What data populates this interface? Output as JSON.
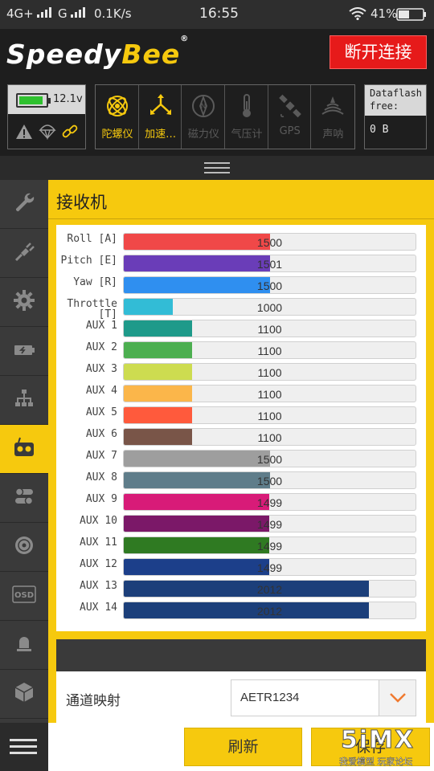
{
  "status_bar": {
    "network1": "4G+",
    "network2": "G",
    "speed": "0.1K/s",
    "time": "16:55",
    "battery_pct": "41%"
  },
  "app": {
    "logo_part1": "Speedy",
    "logo_part2": "Bee",
    "logo_mark": "®",
    "disconnect_label": "断开连接"
  },
  "battery": {
    "voltage": "12.1v",
    "fill_fraction": 0.85,
    "icons": [
      "warning-icon",
      "parachute-icon",
      "link-icon"
    ]
  },
  "sensors": [
    {
      "id": "gyro",
      "label": "陀螺仪",
      "active": true,
      "icon": "gyro-icon"
    },
    {
      "id": "accel",
      "label": "加速…",
      "active": true,
      "icon": "accelerometer-icon"
    },
    {
      "id": "mag",
      "label": "磁力仪",
      "active": false,
      "icon": "compass-icon"
    },
    {
      "id": "baro",
      "label": "气压计",
      "active": false,
      "icon": "thermometer-icon"
    },
    {
      "id": "gps",
      "label": "GPS",
      "active": false,
      "icon": "satellite-icon"
    },
    {
      "id": "sonar",
      "label": "声呐",
      "active": false,
      "icon": "sonar-icon"
    }
  ],
  "dataflash": {
    "label": "Dataflash free:",
    "value": "0 B"
  },
  "sidebar": {
    "items": [
      {
        "icon": "wrench-icon"
      },
      {
        "icon": "plug-icon"
      },
      {
        "icon": "gear-icon"
      },
      {
        "icon": "battery-charge-icon"
      },
      {
        "icon": "network-tree-icon"
      },
      {
        "icon": "receiver-icon",
        "active": true
      },
      {
        "icon": "modes-toggle-icon"
      },
      {
        "icon": "motor-icon"
      },
      {
        "icon": "osd-icon",
        "text": "OSD"
      },
      {
        "icon": "led-strip-icon"
      },
      {
        "icon": "cube-icon"
      }
    ]
  },
  "receiver": {
    "title": "接收机",
    "channels": [
      {
        "label": "Roll [A]",
        "value": 1500,
        "color": "#f04848"
      },
      {
        "label": "Pitch [E]",
        "value": 1501,
        "color": "#6a3db8"
      },
      {
        "label": "Yaw [R]",
        "value": 1500,
        "color": "#2f8ff0"
      },
      {
        "label": "Throttle [T]",
        "value": 1000,
        "color": "#32bcd6"
      },
      {
        "label": "AUX 1",
        "value": 1100,
        "color": "#1e9a8a"
      },
      {
        "label": "AUX 2",
        "value": 1100,
        "color": "#4caf50"
      },
      {
        "label": "AUX 3",
        "value": 1100,
        "color": "#cddc50"
      },
      {
        "label": "AUX 4",
        "value": 1100,
        "color": "#fbb64a"
      },
      {
        "label": "AUX 5",
        "value": 1100,
        "color": "#ff5a3c"
      },
      {
        "label": "AUX 6",
        "value": 1100,
        "color": "#795548"
      },
      {
        "label": "AUX 7",
        "value": 1500,
        "color": "#9e9e9e"
      },
      {
        "label": "AUX 8",
        "value": 1500,
        "color": "#5f7d8a"
      },
      {
        "label": "AUX 9",
        "value": 1499,
        "color": "#d81b78"
      },
      {
        "label": "AUX 10",
        "value": 1499,
        "color": "#7b1868"
      },
      {
        "label": "AUX 11",
        "value": 1499,
        "color": "#2f7a22"
      },
      {
        "label": "AUX 12",
        "value": 1499,
        "color": "#1c3f8a"
      },
      {
        "label": "AUX 13",
        "value": 2012,
        "color": "#1c3f7a"
      },
      {
        "label": "AUX 14",
        "value": 2012,
        "color": "#1c3f7a"
      }
    ],
    "range": [
      750,
      2250
    ]
  },
  "mapping": {
    "label": "通道映射",
    "value": "AETR1234"
  },
  "buttons": {
    "refresh": "刷新",
    "save": "保存"
  },
  "watermark": {
    "big": "5iMX",
    "small": "我爱模型 玩家论坛"
  },
  "accent": "#f6c90e"
}
